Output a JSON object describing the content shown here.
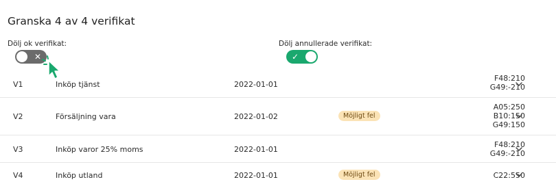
{
  "page": {
    "title": "Granska 4 av 4 verifikat"
  },
  "filters": {
    "hide_ok": {
      "label": "Dölj ok verifikat:",
      "state": "off",
      "glyph": "✕"
    },
    "hide_cancelled": {
      "label": "Dölj annullerade verifikat:",
      "state": "on",
      "glyph": "✓"
    }
  },
  "rows": [
    {
      "id": "V1",
      "description": "Inköp tjänst",
      "date": "2022-01-01",
      "badge": "",
      "accounts": [
        "F48:210",
        "G49:-210"
      ]
    },
    {
      "id": "V2",
      "description": "Försäljning vara",
      "date": "2022-01-02",
      "badge": "Möjligt fel",
      "accounts": [
        "A05:250",
        "B10:150",
        "G49:150"
      ]
    },
    {
      "id": "V3",
      "description": "Inköp varor 25% moms",
      "date": "2022-01-01",
      "badge": "",
      "accounts": [
        "F48:210",
        "G49:-210"
      ]
    },
    {
      "id": "V4",
      "description": "Inköp utland",
      "date": "2022-01-01",
      "badge": "Möjligt fel",
      "accounts": [
        "C22:550"
      ]
    }
  ],
  "colors": {
    "toggle_on": "#1aa86e",
    "toggle_off": "#6b6b6b",
    "badge_bg": "#fbe3b6",
    "cursor_green": "#1aa86e"
  },
  "icons": {
    "row_expand": "chevron-down-icon",
    "pointer": "cursor-icon"
  }
}
